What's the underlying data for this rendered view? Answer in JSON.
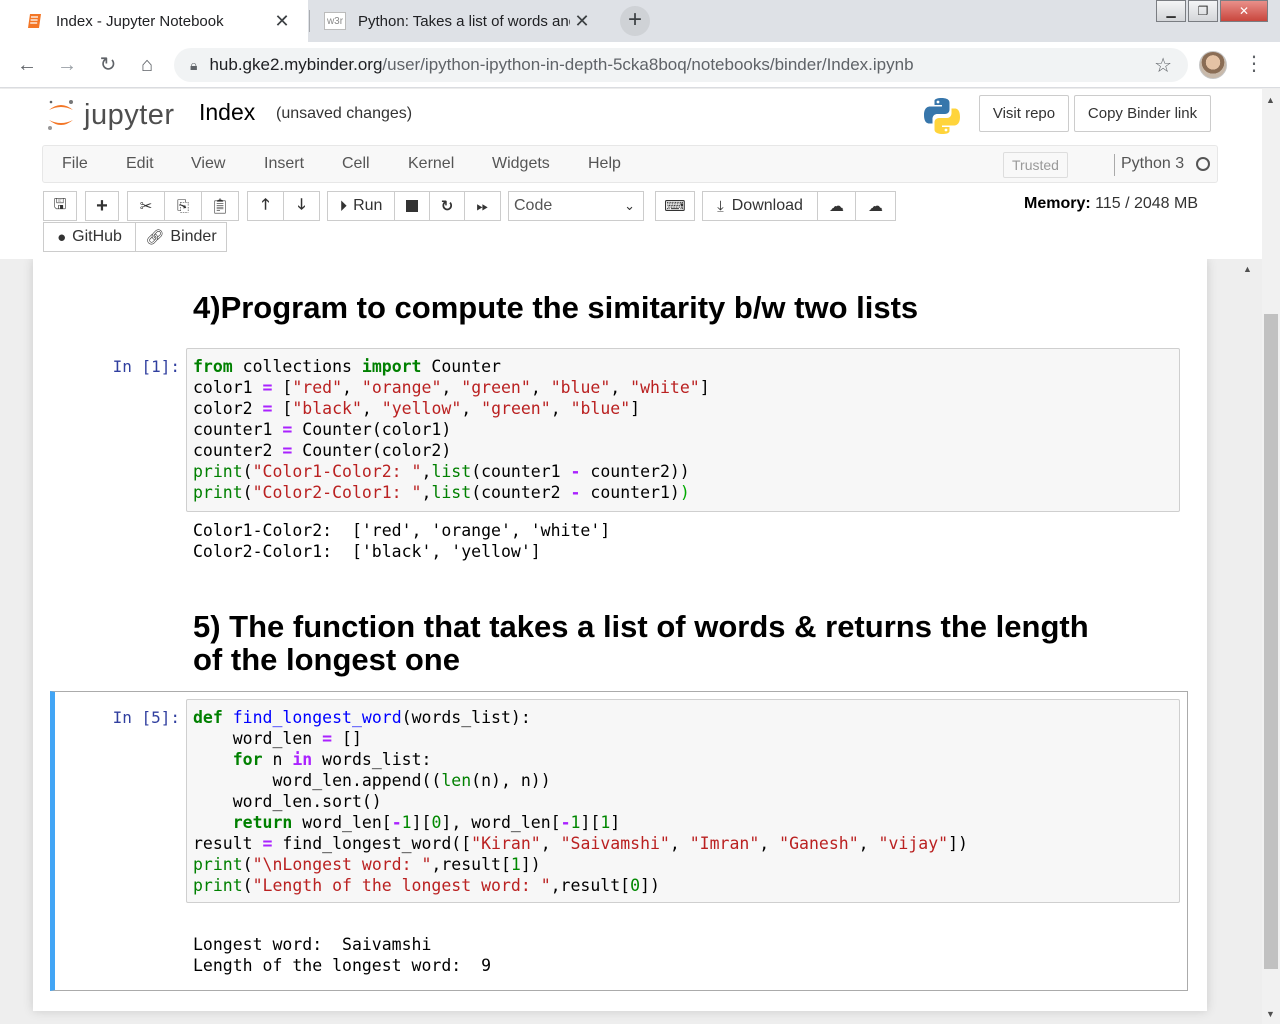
{
  "browser": {
    "tabs": [
      {
        "title": "Index - Jupyter Notebook",
        "close": "✕"
      },
      {
        "title": "Python: Takes a list of words and",
        "favicon": "w3r",
        "close": "✕"
      }
    ],
    "new_tab": "+",
    "url_host": "hub.gke2.mybinder.org",
    "url_path": "/user/ipython-ipython-in-depth-5cka8boq/notebooks/binder/Index.ipynb"
  },
  "jupyter": {
    "logo_text": "jupyter",
    "notebook_name": "Index",
    "save_status": "(unsaved changes)",
    "visit_repo": "Visit repo",
    "copy_binder_link": "Copy Binder link",
    "menu": [
      "File",
      "Edit",
      "View",
      "Insert",
      "Cell",
      "Kernel",
      "Widgets",
      "Help"
    ],
    "trusted": "Trusted",
    "kernel": "Python 3",
    "toolbar": {
      "run": "Run",
      "cell_type": "Code",
      "download": "Download",
      "github": "GitHub",
      "binder": "Binder"
    },
    "memory_label": "Memory:",
    "memory_value": "115 / 2048 MB"
  },
  "notebook": {
    "heading4": "4)Program to compute the simitarity b/w two lists",
    "cell1_prompt": "In [1]:",
    "cell1_output": [
      "Color1-Color2:  ['red', 'orange', 'white']",
      "Color2-Color1:  ['black', 'yellow']"
    ],
    "heading5_line1": "5) The function that takes a list of words & returns the length",
    "heading5_line2": "of the longest one",
    "cell5_prompt": "In [5]:",
    "cell5_output": [
      "Longest word:  Saivamshi",
      "Length of the longest word:  9"
    ]
  },
  "colors": {
    "prompt_in": "#303F9F",
    "selected_cell_border": "#42A5F5",
    "keyword": "#008000",
    "string": "#BA2121",
    "operator": "#AA22FF"
  }
}
